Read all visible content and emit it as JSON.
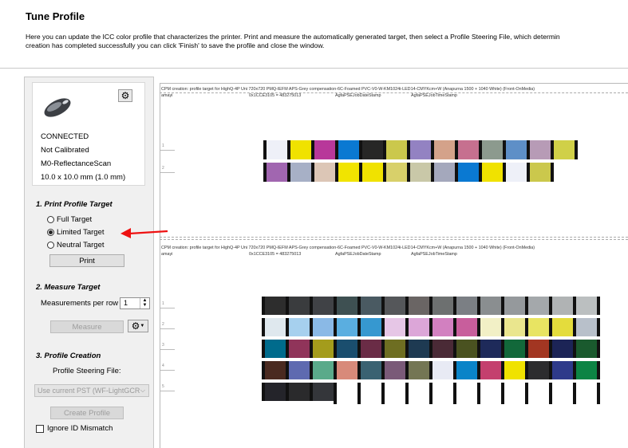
{
  "window": {
    "title": "Tune Profile",
    "description": "Here you can update the ICC color profile that characterizes the printer.  Print and measure the automatically generated target, then select a Profile Steering File, which determin\ncreation has completed successfully you can click 'Finish' to save the profile and close the window."
  },
  "device": {
    "status": "CONNECTED",
    "calibration": "Not Calibrated",
    "mode": "M0-ReflectanceScan",
    "aperture": "10.0 x 10.0 mm (1.0 mm)"
  },
  "print_section": {
    "heading": "1. Print Profile Target",
    "options": [
      "Full Target",
      "Limited Target",
      "Neutral Target"
    ],
    "selected_index": 1,
    "print_label": "Print"
  },
  "measure_section": {
    "heading": "2. Measure Target",
    "rows_label": "Measurements per row",
    "rows_value": "1",
    "measure_label": "Measure"
  },
  "profile_section": {
    "heading": "3. Profile Creation",
    "psf_label": "Profile Steering File:",
    "psf_value": "Use current PST (WF-LightGCR",
    "create_label": "Create Profile",
    "ignore_label": "Ignore ID Mismatch"
  },
  "targets": {
    "header": "CPM creation: profile target for HighQ-4P Uni 720x720 PMQ-IEFM APS-Grey compensation-6C-Foamed PVC-V0-W-KM1024i-LED14-CMYKcm+W (Anapurna 1500 + 1040 White) (Front-OnMedia)",
    "user": "amayi",
    "id": "0x1CCE3105 = 483275013",
    "date_stamp": "AgfaPSEJobDateStamp",
    "time_stamp": "AgfaPSEJobTimeStamp",
    "row_numbers": [
      "1",
      "2",
      "3",
      "4",
      "5"
    ]
  },
  "limited_rows": [
    [
      "#eef0f8",
      "#f0e200",
      "#b8389a",
      "#0a79d2",
      "#272726",
      "#cbc84c",
      "#9382c2",
      "#d4a28a",
      "#c6708f",
      "#8c9a8e",
      "#5e8fc7",
      "#b79bb6",
      "#d0d048"
    ],
    [
      "#a166b0",
      "#a7b0c6",
      "#dcc6b6",
      "#f1e400",
      "#f0e200",
      "#d8d06a",
      "#c9c8a8",
      "#a4a8bc",
      "#0a79d2",
      "#f0e200",
      "#eef0f8",
      "#cbc84c"
    ]
  ],
  "full_rows": [
    [
      "#2d2d2d",
      "#3a3c3e",
      "#404246",
      "#3e5052",
      "#4a5a62",
      "#55575a",
      "#6a6564",
      "#6d7070",
      "#7b7f84",
      "#8a8e90",
      "#95999c",
      "#a4a8ab",
      "#b0b3b4",
      "#bbbfc0"
    ],
    [
      "#dfe8ee",
      "#a6d0ee",
      "#8ab9e6",
      "#5aaee0",
      "#3698d0",
      "#e6c6e6",
      "#dca6d8",
      "#d280c0",
      "#c85e9c",
      "#f2f0c6",
      "#eae68e",
      "#e8e462",
      "#e4dc3c",
      "#b8c0ca"
    ],
    [
      "#006b8c",
      "#90345a",
      "#a49c1c",
      "#1a4e6e",
      "#6a2c46",
      "#6e6e22",
      "#1e3a52",
      "#4a2a36",
      "#4a5220",
      "#1e2a5a",
      "#12683a",
      "#a23622",
      "#1c2456",
      "#1a5a2e"
    ],
    [
      "#4a2a20",
      "#5e6ab0",
      "#5aaa8a",
      "#d88a7a",
      "#3a6272",
      "#7a5a78",
      "#747654",
      "#e8eaf4",
      "#0a84c8",
      "#c4406e",
      "#f0e200",
      "#2c2c2e",
      "#2e3a8a",
      "#0c8444"
    ],
    [
      "#24242a",
      "#2a2a2c",
      "#34363a"
    ]
  ]
}
